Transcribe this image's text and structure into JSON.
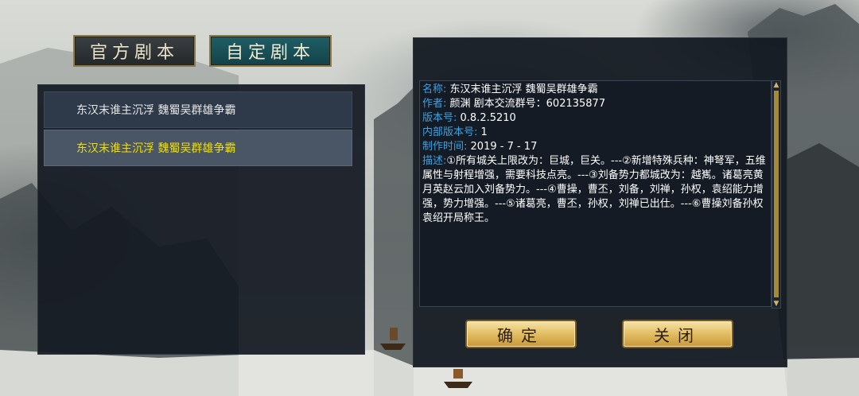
{
  "tabs": {
    "official_label": "官方剧本",
    "custom_label": "自定剧本"
  },
  "scenario_list": [
    {
      "title": "东汉末谁主沉浮  魏蜀吴群雄争霸",
      "selected": false
    },
    {
      "title": "东汉末谁主沉浮  魏蜀吴群雄争霸",
      "selected": true
    }
  ],
  "details": {
    "name_label": "名称:",
    "name_value": "东汉末谁主沉浮  魏蜀吴群雄争霸",
    "author_label": "作者:",
    "author_value": "颜渊  剧本交流群号：602135877",
    "version_label": "版本号:",
    "version_value": "0.8.2.5210",
    "internal_version_label": "内部版本号:",
    "internal_version_value": "1",
    "created_label": "制作时间:",
    "created_value": "2019 - 7 - 17",
    "desc_label": "描述:",
    "desc_value": "①所有城关上限改为：巨城，巨关。---②新增特殊兵种：神弩军，五维属性与射程增强，需要科技点亮。---③刘备势力都城改为：越嶲。诸葛亮黄月英赵云加入刘备势力。---④曹操，曹丕，刘备，刘禅，孙权，袁绍能力增强，势力增强。---⑤诸葛亮，曹丕，孙权，刘禅已出仕。---⑥曹操刘备孙权袁绍开局称王。"
  },
  "buttons": {
    "confirm_label": "确定",
    "close_label": "关闭"
  },
  "colors": {
    "label_blue": "#3aa3e6",
    "selected_yellow": "#f0e000",
    "gold": "#e3bd62"
  }
}
